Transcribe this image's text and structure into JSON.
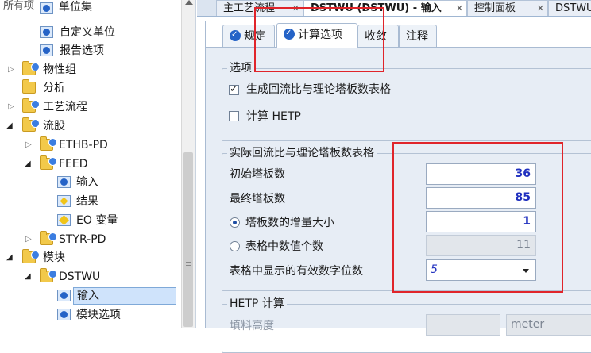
{
  "tree": {
    "header": "所有项",
    "items": [
      {
        "label": "单位集",
        "icon": "unit-set-icon"
      },
      {
        "label": "自定义单位",
        "icon": "checked-form-icon"
      },
      {
        "label": "报告选项",
        "icon": "checked-form-icon"
      },
      {
        "label": "物性组",
        "icon": "folder-icon"
      },
      {
        "label": "分析",
        "icon": "folder-icon"
      },
      {
        "label": "工艺流程",
        "icon": "folder-icon"
      },
      {
        "label": "流股",
        "icon": "folder-icon"
      },
      {
        "label": "ETHB-PD",
        "icon": "folder-icon"
      },
      {
        "label": "FEED",
        "icon": "folder-icon"
      },
      {
        "label": "输入",
        "icon": "checked-form-icon"
      },
      {
        "label": "结果",
        "icon": "results-icon"
      },
      {
        "label": "EO 变量",
        "icon": "eo-variables-icon"
      },
      {
        "label": "STYR-PD",
        "icon": "folder-icon"
      },
      {
        "label": "模块",
        "icon": "folder-icon"
      },
      {
        "label": "DSTWU",
        "icon": "folder-icon"
      },
      {
        "label": "输入",
        "icon": "checked-form-icon",
        "selected": true
      },
      {
        "label": "模块选项",
        "icon": "checked-form-icon"
      }
    ]
  },
  "doc_tabs": [
    {
      "label": "主工艺流程",
      "active": false
    },
    {
      "label": "DSTWU (DSTWU) - 输入",
      "active": true
    },
    {
      "label": "控制面板",
      "active": false
    },
    {
      "label": "DSTWU (DSTWU)",
      "active": false
    }
  ],
  "form_tabs": [
    {
      "label": "规定",
      "icon": "checked-form-icon"
    },
    {
      "label": "计算选项",
      "icon": "checked-form-icon",
      "active": true
    },
    {
      "label": "收敛"
    },
    {
      "label": "注释"
    }
  ],
  "options": {
    "title": "选项",
    "generate_table": {
      "label": "生成回流比与理论塔板数表格",
      "checked": true
    },
    "calc_hetp": {
      "label": "计算 HETP",
      "checked": false
    }
  },
  "table_group": {
    "title": "实际回流比与理论塔板数表格",
    "initial_stages": {
      "label": "初始塔板数",
      "value": "36"
    },
    "final_stages": {
      "label": "最终塔板数",
      "value": "85"
    },
    "increment": {
      "label": "塔板数的增量大小",
      "value": "1",
      "selected": true
    },
    "num_values": {
      "label": "表格中数值个数",
      "value": "11",
      "selected": false
    },
    "sig_digits": {
      "label": "表格中显示的有效数字位数",
      "value": "5"
    }
  },
  "hetp_group": {
    "title": "HETP 计算",
    "packing_height": {
      "label": "填料高度",
      "unit": "meter"
    }
  },
  "colors": {
    "highlight": "#e0242a",
    "value_text": "#1f2fbf",
    "panel_bg": "#e7edf5"
  }
}
